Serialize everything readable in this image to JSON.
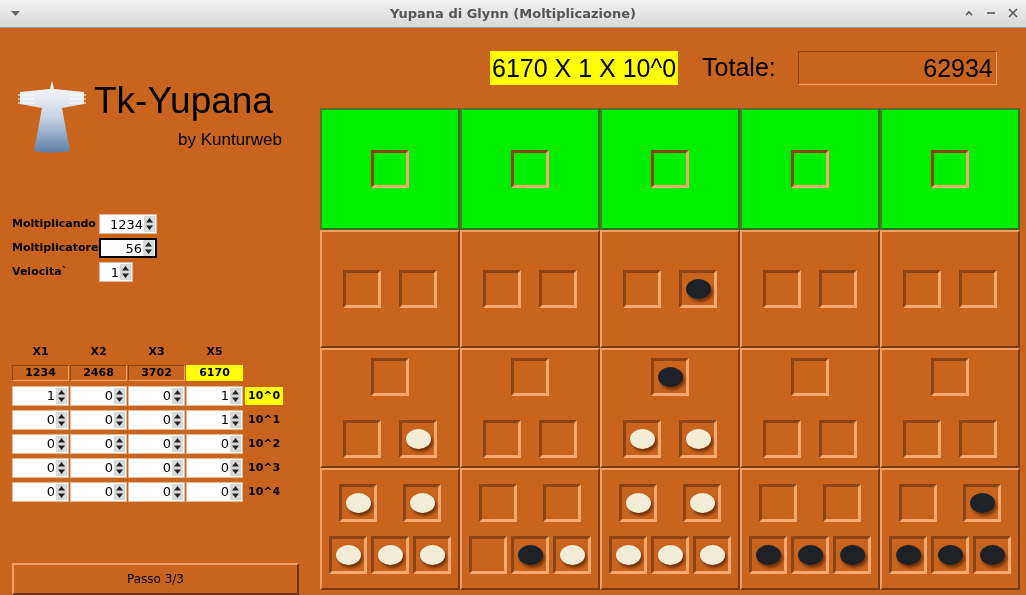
{
  "window": {
    "title": "Yupana di Glynn (Moltiplicazione)"
  },
  "logo": {
    "title": "Tk-Yupana",
    "subtitle": "by Kunturweb"
  },
  "inputs": [
    {
      "label": "Moltiplicando",
      "value": "1234",
      "focused": false
    },
    {
      "label": "Moltiplicatore",
      "value": "56",
      "focused": true
    },
    {
      "label": "Velocita`",
      "value": "1",
      "focused": false
    }
  ],
  "products": {
    "columns": [
      {
        "label": "X1",
        "value": "1234",
        "selected": false
      },
      {
        "label": "X2",
        "value": "2468",
        "selected": false
      },
      {
        "label": "X3",
        "value": "3702",
        "selected": false
      },
      {
        "label": "X5",
        "value": "6170",
        "selected": true
      }
    ],
    "rows": [
      {
        "power": "10^0",
        "selected": true,
        "values": [
          "1",
          "0",
          "0",
          "1"
        ]
      },
      {
        "power": "10^1",
        "selected": false,
        "values": [
          "0",
          "0",
          "0",
          "1"
        ]
      },
      {
        "power": "10^2",
        "selected": false,
        "values": [
          "0",
          "0",
          "0",
          "0"
        ]
      },
      {
        "power": "10^3",
        "selected": false,
        "values": [
          "0",
          "0",
          "0",
          "0"
        ]
      },
      {
        "power": "10^4",
        "selected": false,
        "values": [
          "0",
          "0",
          "0",
          "0"
        ]
      }
    ]
  },
  "step_button": "Passo 3/3",
  "operation": "6170 X 1 X 10^0",
  "total": {
    "label": "Totale:",
    "value": "62934"
  },
  "yupana": {
    "rows": [
      {
        "highlighted": true,
        "cells": [
          [
            {
              "filled": false
            }
          ],
          [
            {
              "filled": false
            }
          ],
          [
            {
              "filled": false
            }
          ],
          [
            {
              "filled": false
            }
          ],
          [
            {
              "filled": false
            }
          ]
        ]
      },
      {
        "highlighted": false,
        "cells": [
          [
            {
              "filled": false
            },
            {
              "filled": false
            }
          ],
          [
            {
              "filled": false
            },
            {
              "filled": false
            }
          ],
          [
            {
              "filled": false
            },
            {
              "filled": true,
              "color": "#1e2226"
            }
          ],
          [
            {
              "filled": false
            },
            {
              "filled": false
            }
          ],
          [
            {
              "filled": false
            },
            {
              "filled": false
            }
          ]
        ]
      },
      {
        "highlighted": false,
        "cells": [
          [
            {
              "filled": false
            },
            {
              "filled": false
            },
            {
              "filled": true,
              "color": "#f3ecd6"
            }
          ],
          [
            {
              "filled": false
            },
            {
              "filled": false
            },
            {
              "filled": false
            }
          ],
          [
            {
              "filled": true,
              "color": "#1e2226"
            },
            {
              "filled": true,
              "color": "#f3ecd6"
            },
            {
              "filled": true,
              "color": "#f3ecd6"
            }
          ],
          [
            {
              "filled": false
            },
            {
              "filled": false
            },
            {
              "filled": false
            }
          ],
          [
            {
              "filled": false
            },
            {
              "filled": false
            },
            {
              "filled": false
            }
          ]
        ]
      },
      {
        "highlighted": false,
        "cells": [
          [
            {
              "filled": true,
              "color": "#f3ecd6"
            },
            {
              "filled": true,
              "color": "#f3ecd6"
            },
            {
              "filled": true,
              "color": "#f3ecd6"
            },
            {
              "filled": true,
              "color": "#f3ecd6"
            },
            {
              "filled": true,
              "color": "#f3ecd6"
            }
          ],
          [
            {
              "filled": false
            },
            {
              "filled": false
            },
            {
              "filled": false
            },
            {
              "filled": true,
              "color": "#1e2226"
            },
            {
              "filled": true,
              "color": "#f3ecd6"
            }
          ],
          [
            {
              "filled": true,
              "color": "#f3ecd6"
            },
            {
              "filled": true,
              "color": "#f3ecd6"
            },
            {
              "filled": true,
              "color": "#f3ecd6"
            },
            {
              "filled": true,
              "color": "#f3ecd6"
            },
            {
              "filled": true,
              "color": "#f3ecd6"
            }
          ],
          [
            {
              "filled": false
            },
            {
              "filled": false
            },
            {
              "filled": true,
              "color": "#1e2226"
            },
            {
              "filled": true,
              "color": "#1e2226"
            },
            {
              "filled": true,
              "color": "#1e2226"
            }
          ],
          [
            {
              "filled": false
            },
            {
              "filled": true,
              "color": "#1e2226"
            },
            {
              "filled": true,
              "color": "#1e2226"
            },
            {
              "filled": true,
              "color": "#1e2226"
            },
            {
              "filled": true,
              "color": "#1e2226"
            }
          ]
        ]
      }
    ]
  }
}
